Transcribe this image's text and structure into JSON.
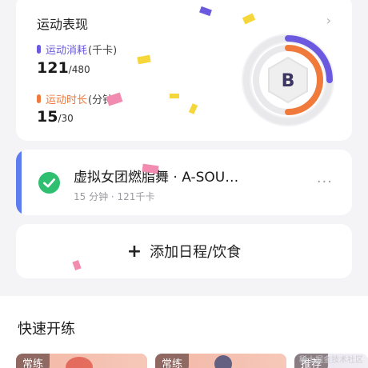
{
  "performance": {
    "title": "运动表现",
    "calories": {
      "label": "运动消耗",
      "unit": "(千卡)",
      "value": "121",
      "target": "/480",
      "progress": 0.25,
      "color": "#6b5ae0"
    },
    "duration": {
      "label": "运动时长",
      "unit": "(分钟",
      "value": "15",
      "target": "/30",
      "progress": 0.5,
      "color": "#f07a3c"
    },
    "grade": "B"
  },
  "schedule": {
    "name": "虚拟女团燃脂舞 · A-SOU…",
    "meta": "15 分钟 · 121千卡",
    "status_color": "#2fbf71",
    "accent": "#5c7cf0"
  },
  "add_schedule": {
    "label": "添加日程/饮食"
  },
  "quick_start": {
    "title": "快速开练",
    "tiles": [
      {
        "tag": "常练"
      },
      {
        "tag": "常练"
      },
      {
        "tag": "推荐"
      }
    ]
  },
  "watermark": "稀土掘金技术社区",
  "icons": {
    "chevron": "chevron-right-icon",
    "check": "check-circle-icon",
    "more": "more-dots-icon",
    "plus": "plus-icon"
  }
}
